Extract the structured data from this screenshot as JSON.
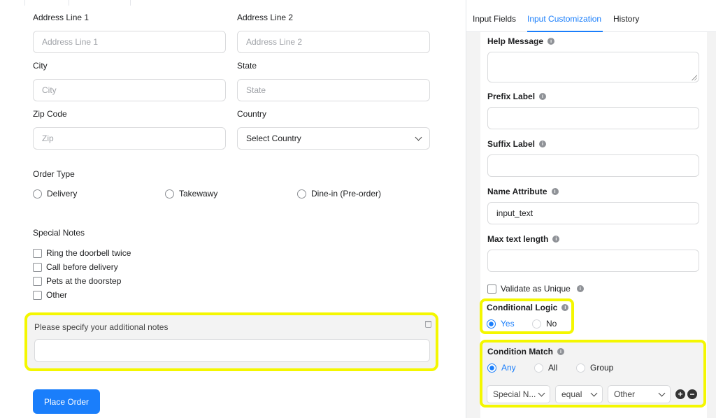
{
  "form": {
    "address1": {
      "label": "Address Line 1",
      "placeholder": "Address Line 1"
    },
    "address2": {
      "label": "Address Line 2",
      "placeholder": "Address Line 2"
    },
    "city": {
      "label": "City",
      "placeholder": "City"
    },
    "state": {
      "label": "State",
      "placeholder": "State"
    },
    "zip": {
      "label": "Zip Code",
      "placeholder": "Zip"
    },
    "country": {
      "label": "Country",
      "value": "Select Country"
    },
    "order_type": {
      "label": "Order Type",
      "options": [
        "Delivery",
        "Takewawy",
        "Dine-in (Pre-order)"
      ]
    },
    "special_notes": {
      "label": "Special Notes",
      "options": [
        "Ring the doorbell twice",
        "Call before delivery",
        "Pets at the doorstep",
        "Other"
      ]
    },
    "additional_notes": {
      "label": "Please specify your additional notes"
    },
    "submit_label": "Place Order"
  },
  "panel": {
    "tabs": [
      "Input Fields",
      "Input Customization",
      "History"
    ],
    "help_message": {
      "label": "Help Message"
    },
    "prefix_label": {
      "label": "Prefix Label"
    },
    "suffix_label": {
      "label": "Suffix Label"
    },
    "name_attribute": {
      "label": "Name Attribute",
      "value": "input_text"
    },
    "max_text_length": {
      "label": "Max text length"
    },
    "validate_unique": {
      "label": "Validate as Unique"
    },
    "conditional_logic": {
      "label": "Conditional Logic",
      "options": [
        "Yes",
        "No"
      ],
      "selected": "Yes"
    },
    "condition_match": {
      "label": "Condition Match",
      "options": [
        "Any",
        "All",
        "Group"
      ],
      "selected": "Any"
    },
    "rule": {
      "field": "Special N...",
      "operator": "equal",
      "value": "Other"
    },
    "info_glyph": "i",
    "add_glyph": "+",
    "remove_glyph": "−"
  },
  "colors": {
    "accent": "#1a7efb",
    "highlight": "#f4f700"
  }
}
